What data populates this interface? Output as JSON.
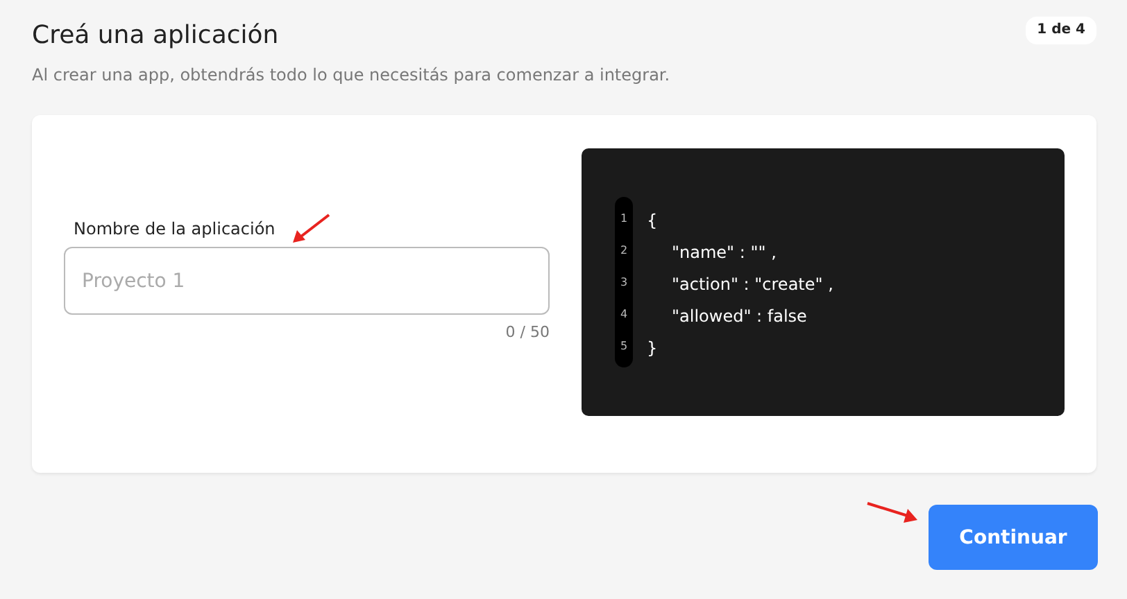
{
  "header": {
    "title": "Creá una aplicación",
    "subtitle": "Al crear una app, obtendrás todo lo que necesitás para comenzar a integrar.",
    "step_badge": "1 de 4"
  },
  "form": {
    "label": "Nombre de la aplicación",
    "placeholder": "Proyecto 1",
    "counter": "0 / 50"
  },
  "code": {
    "lines": [
      {
        "number": "1",
        "text": "{",
        "indented": false
      },
      {
        "number": "2",
        "text": "\"name\" : \"\" ,",
        "indented": true
      },
      {
        "number": "3",
        "text": "\"action\" : \"create\" ,",
        "indented": true
      },
      {
        "number": "4",
        "text": "\"allowed\" : false",
        "indented": true
      },
      {
        "number": "5",
        "text": "}",
        "indented": false
      }
    ]
  },
  "button": "Continuar"
}
